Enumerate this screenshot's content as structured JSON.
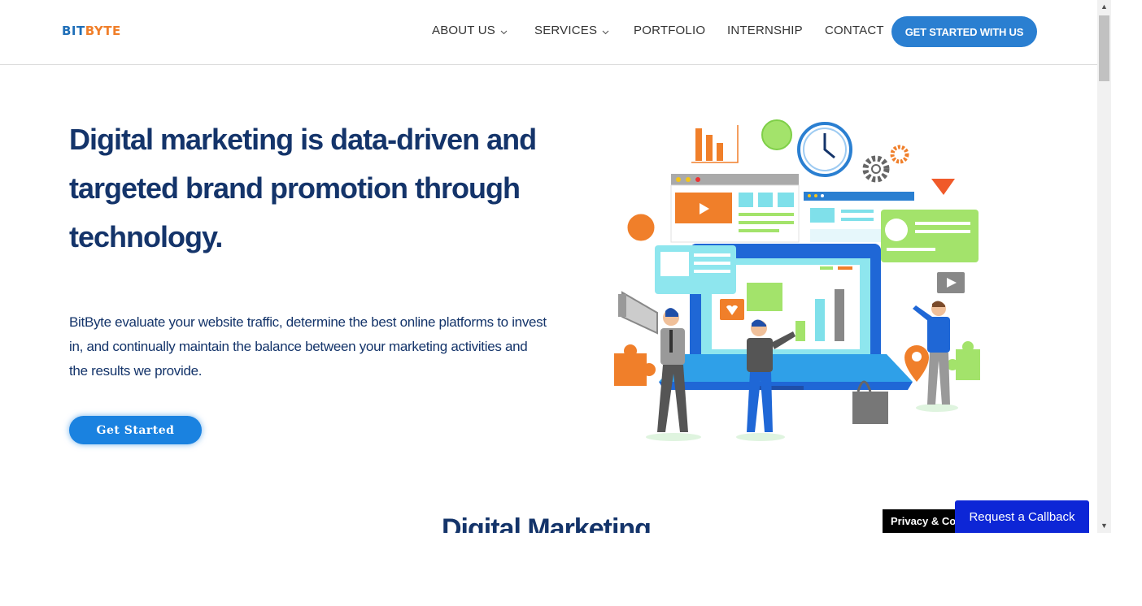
{
  "logo": {
    "part1": "BIT",
    "part2": "BYTE"
  },
  "nav": {
    "about": "ABOUT US",
    "services": "SERVICES",
    "portfolio": "PORTFOLIO",
    "internship": "INTERNSHIP",
    "contact": "CONTACT",
    "cta": "GET STARTED WITH US"
  },
  "hero": {
    "title": "Digital marketing is data-driven and targeted brand promotion through technology.",
    "description": "BitByte evaluate your website traffic, determine the best online platforms to invest in, and continually maintain the balance between your marketing activities and the results we provide.",
    "button": "Get Started"
  },
  "section": {
    "title": "Digital Marketing"
  },
  "privacy_label": "Privacy & Cookies Policy",
  "callback_label": "Request a Callback",
  "colors": {
    "primary": "#2a7fd1",
    "heading": "#14346a",
    "accent": "#f07f2a",
    "callback": "#0d26d6"
  }
}
